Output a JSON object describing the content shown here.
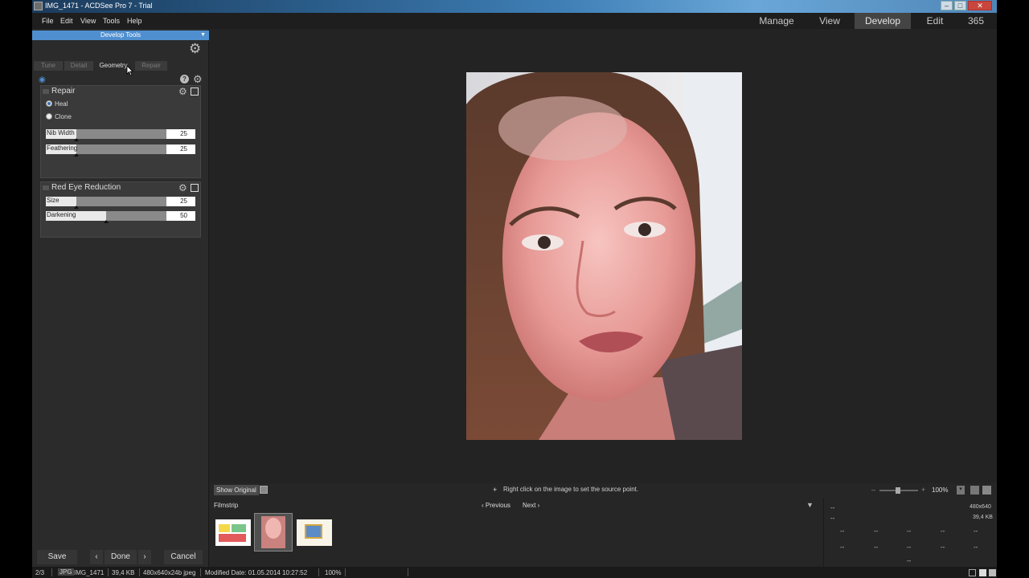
{
  "window": {
    "title": "IMG_1471 - ACDSee Pro 7 - Trial"
  },
  "menu": {
    "items": [
      "File",
      "Edit",
      "View",
      "Tools",
      "Help"
    ]
  },
  "modes": {
    "items": [
      "Manage",
      "View",
      "Develop",
      "Edit",
      "365"
    ],
    "active": "Develop"
  },
  "left_panel": {
    "header": "Develop Tools",
    "tabs": [
      "Tune",
      "Detail",
      "Geometry",
      "Repair"
    ],
    "active_tab": "Geometry",
    "repair": {
      "title": "Repair",
      "options": [
        "Heal",
        "Clone"
      ],
      "selected": "Heal",
      "sliders": [
        {
          "label": "Nib Width",
          "value": "25",
          "fraction": 0.25
        },
        {
          "label": "Feathering",
          "value": "25",
          "fraction": 0.25
        }
      ]
    },
    "red_eye": {
      "title": "Red Eye Reduction",
      "sliders": [
        {
          "label": "Size",
          "value": "25",
          "fraction": 0.25
        },
        {
          "label": "Darkening",
          "value": "50",
          "fraction": 0.5
        }
      ]
    },
    "buttons": {
      "save": "Save",
      "prev": "‹",
      "done": "Done",
      "next": "›",
      "cancel": "Cancel"
    }
  },
  "viewer_bar": {
    "show_original": "Show Original",
    "hint": "Right click on the image to set the source point.",
    "zoom": "100%"
  },
  "filmstrip": {
    "label": "Filmstrip",
    "previous": "Previous",
    "next": "Next"
  },
  "info": {
    "dims": "480x640",
    "size": "39,4 KB",
    "placeholder": "--"
  },
  "status": {
    "position": "2/3",
    "format": "JPG",
    "filename": "IMG_1471",
    "filesize": "39,4 KB",
    "dims": "480x640x24b jpeg",
    "modified": "Modified Date: 01.05.2014 10:27:52",
    "zoom": "100%"
  },
  "colors": {
    "accent": "#4f8fd0",
    "panel": "#2b2b2b",
    "background": "#232323"
  }
}
